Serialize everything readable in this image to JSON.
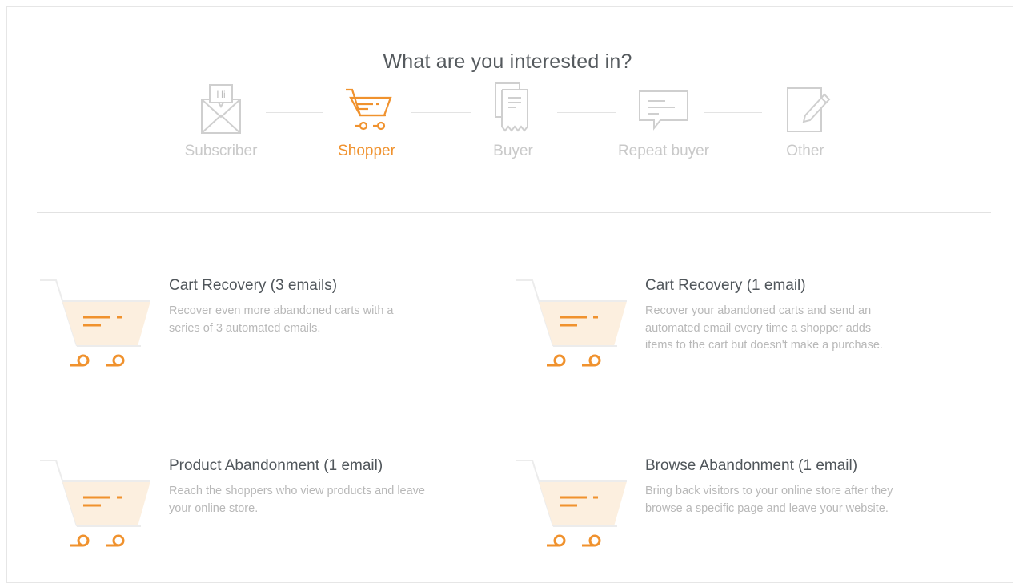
{
  "heading": "What are you interested in?",
  "steps": [
    {
      "label": "Subscriber",
      "icon": "envelope-hi-icon",
      "active": false
    },
    {
      "label": "Shopper",
      "icon": "shopping-cart-icon",
      "active": true
    },
    {
      "label": "Buyer",
      "icon": "receipt-icon",
      "active": false
    },
    {
      "label": "Repeat buyer",
      "icon": "chat-message-icon",
      "active": false
    },
    {
      "label": "Other",
      "icon": "edit-document-icon",
      "active": false
    }
  ],
  "envelope_text": "Hi",
  "cards": [
    {
      "title": "Cart Recovery (3 emails)",
      "description": "Recover even more abandoned carts with a series of 3 automated emails."
    },
    {
      "title": "Cart Recovery (1 email)",
      "description": "Recover your abandoned carts and send an automated email every time a shopper adds items to the cart but doesn't make a purchase."
    },
    {
      "title": "Product Abandonment (1 email)",
      "description": "Reach the shoppers who view products and leave your online store."
    },
    {
      "title": "Browse Abandonment (1 email)",
      "description": "Bring back visitors to your online store after they browse a specific page and leave your website."
    }
  ],
  "colors": {
    "accent": "#f0922e",
    "inactive": "#c9c9c9",
    "title": "#50565b",
    "description": "#b8b8b8",
    "cart_fill": "#fcefdf"
  }
}
